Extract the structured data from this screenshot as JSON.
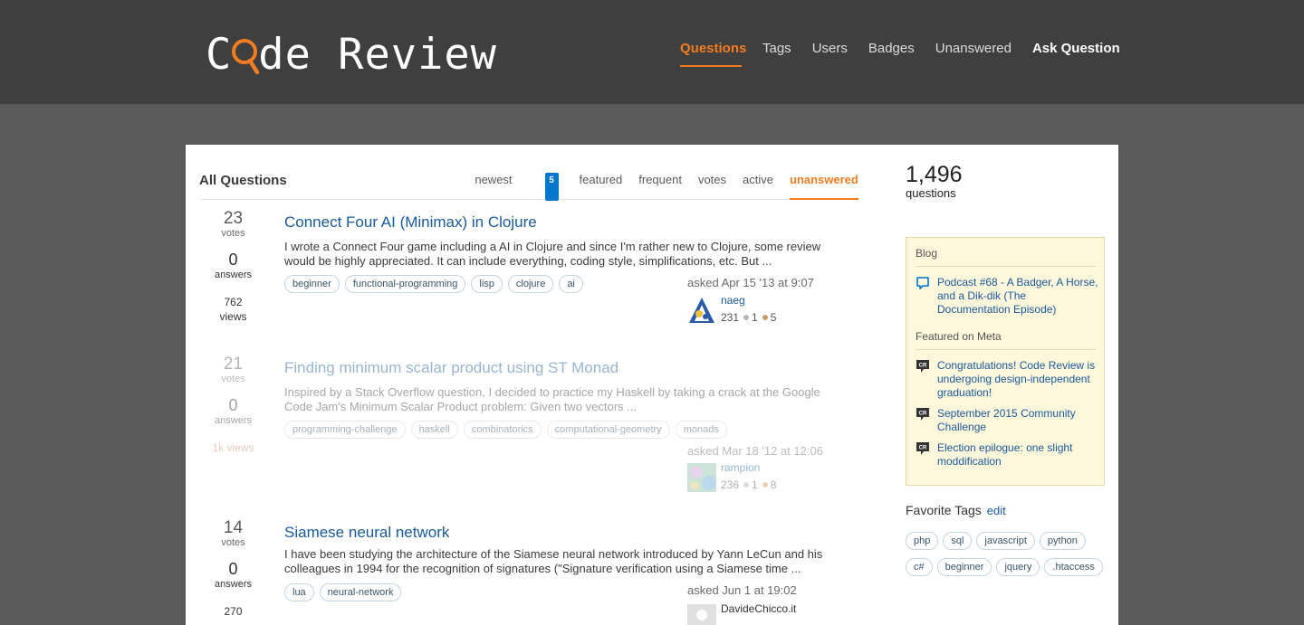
{
  "header": {
    "logo": {
      "pre": "C",
      "post": "de Review"
    },
    "nav": [
      "Questions",
      "Tags",
      "Users",
      "Badges",
      "Unanswered",
      "Ask Question"
    ]
  },
  "list": {
    "title": "All Questions",
    "tabs": {
      "newest": "newest",
      "featured_count": "5",
      "featured": "featured",
      "frequent": "frequent",
      "votes": "votes",
      "active": "active",
      "unanswered": "unanswered"
    }
  },
  "questions": [
    {
      "votes": "23",
      "votes_label": "votes",
      "answers": "0",
      "answers_label": "answers",
      "views": "762",
      "views_label": "views",
      "title": "Connect Four AI (Minimax) in Clojure",
      "excerpt": "I wrote a Connect Four game including a AI in Clojure and since I'm rather new to Clojure, some review would be highly appreciated. It can include everything, coding style, simplifications, etc. But ...",
      "tags": [
        "beginner",
        "functional-programming",
        "lisp",
        "clojure",
        "ai"
      ],
      "asked": "asked Apr 15 '13 at 9:07",
      "user": "naeg",
      "rep": "231",
      "silver": "1",
      "bronze": "5"
    },
    {
      "votes": "21",
      "votes_label": "votes",
      "answers": "0",
      "answers_label": "answers",
      "views": "1k views",
      "title": "Finding minimum scalar product using ST Monad",
      "excerpt": "Inspired by a Stack Overflow question, I decided to practice my Haskell by taking a crack at the Google Code Jam's Minimum Scalar Product problem: Given two vectors ...",
      "tags": [
        "programming-challenge",
        "haskell",
        "combinatorics",
        "computational-geometry",
        "monads"
      ],
      "asked": "asked Mar 18 '12 at 12:06",
      "user": "rampion",
      "rep": "236",
      "silver": "1",
      "bronze": "8"
    },
    {
      "votes": "14",
      "votes_label": "votes",
      "answers": "0",
      "answers_label": "answers",
      "views": "270",
      "title": "Siamese neural network",
      "excerpt": "I have been studying the architecture of the Siamese neural network introduced by Yann LeCun and his colleagues in 1994 for the recognition of signatures (\"Signature verification using a Siamese time ...",
      "tags": [
        "lua",
        "neural-network"
      ],
      "asked": "asked Jun 1 at 19:02",
      "user": "DavideChicco.it"
    }
  ],
  "sidebar": {
    "count": "1,496",
    "count_label": "questions",
    "blog_head": "Blog",
    "blog_items": [
      "Podcast #68 - A Badger, A Horse, and a Dik-dik (The Documentation Episode)"
    ],
    "meta_head": "Featured on Meta",
    "meta_items": [
      "Congratulations! Code Review is undergoing design-independent graduation!",
      "September 2015 Community Challenge",
      "Election epilogue: one slight moddification"
    ],
    "meta_icon_text": "CR",
    "fav_head": "Favorite Tags",
    "fav_edit": "edit",
    "fav_tags": [
      "php",
      "sql",
      "javascript",
      "python",
      "c#",
      "beginner",
      "jquery",
      ".htaccess"
    ]
  },
  "colors": {
    "accent": "#f47c20",
    "link": "#1a5a9a",
    "header_bg": "#3f3f3f",
    "page_bg": "#5b5b5b"
  }
}
